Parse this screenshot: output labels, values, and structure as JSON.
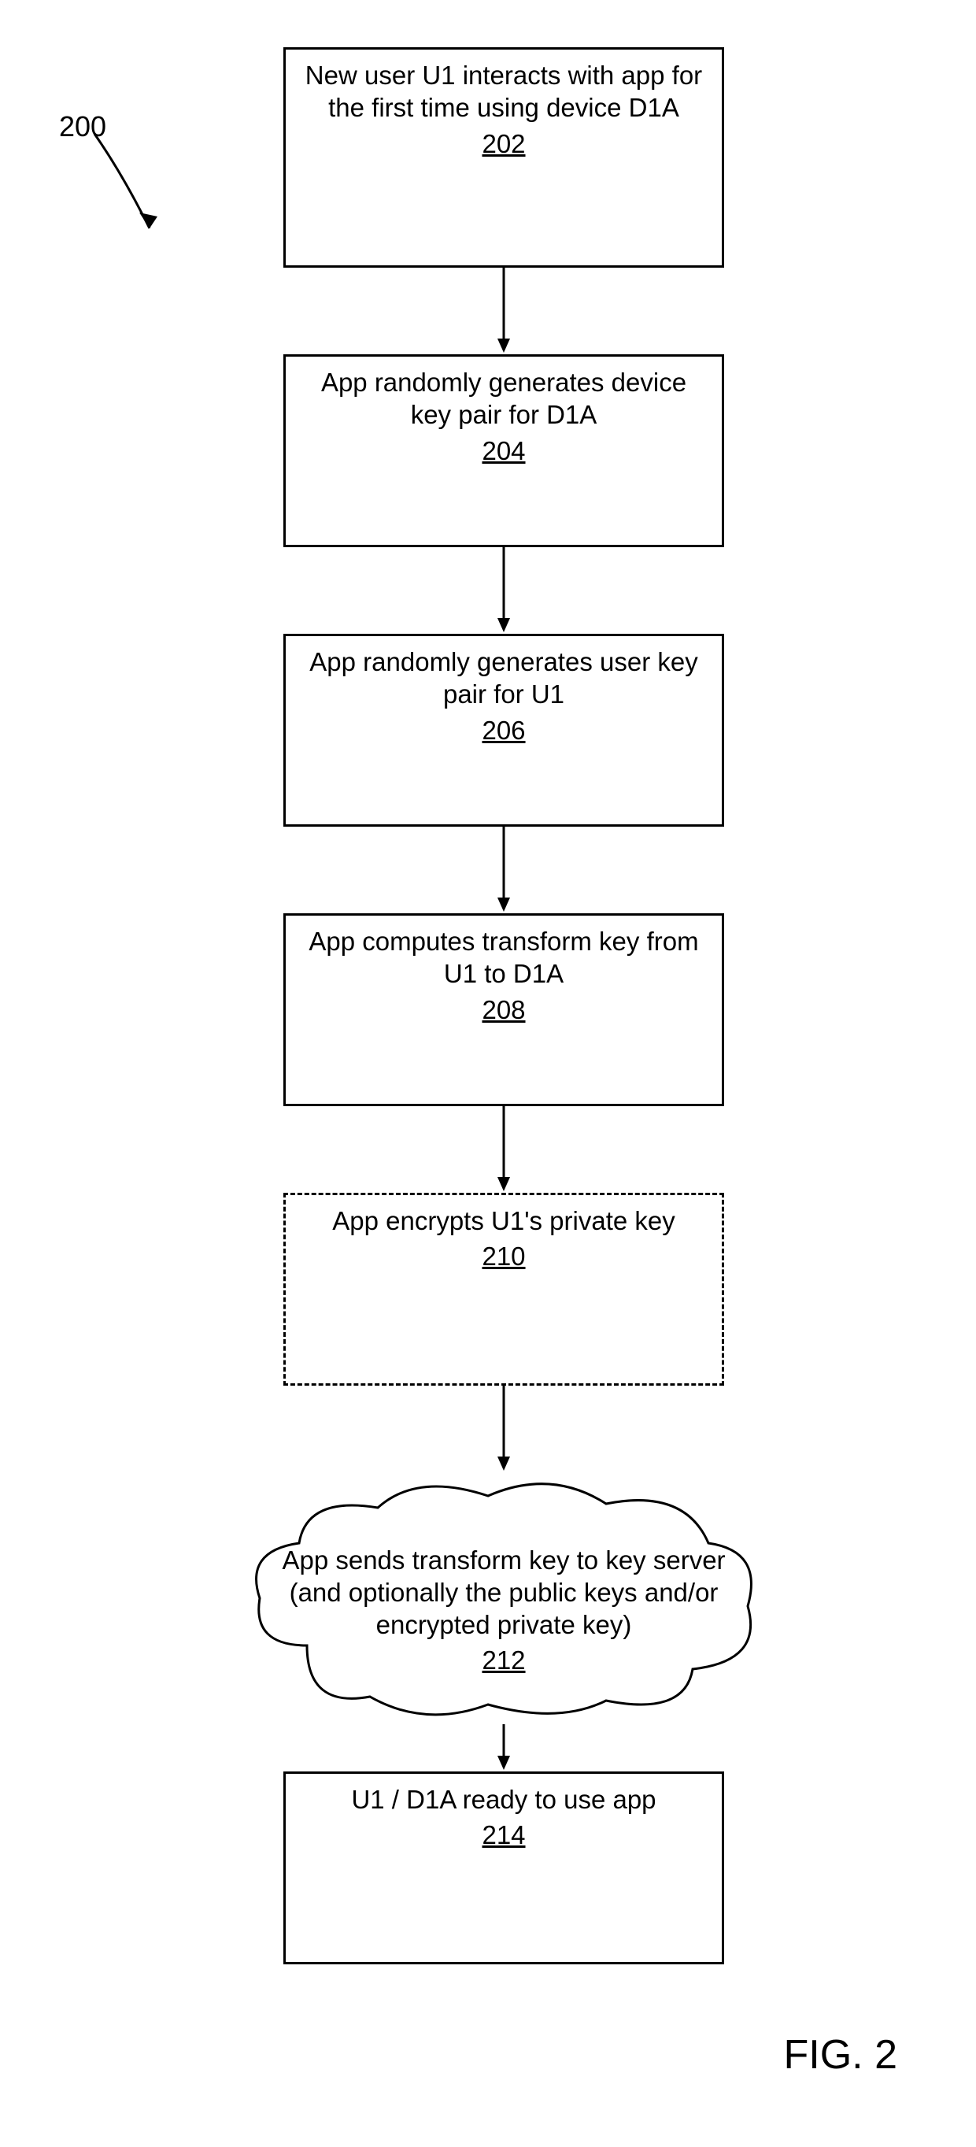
{
  "diagram_number": "200",
  "figure_label": "FIG. 2",
  "steps": {
    "s202": {
      "text": "New user U1 interacts with app for the first time using device D1A",
      "num": "202"
    },
    "s204": {
      "text": "App randomly generates device key pair for D1A",
      "num": "204"
    },
    "s206": {
      "text": "App randomly generates user key pair for U1",
      "num": "206"
    },
    "s208": {
      "text": "App computes transform key from U1 to D1A",
      "num": "208"
    },
    "s210": {
      "text": "App encrypts U1's private key",
      "num": "210"
    },
    "s212": {
      "text": "App sends transform key to key server (and optionally the public keys and/or encrypted private key)",
      "num": "212"
    },
    "s214": {
      "text": "U1 / D1A ready to use app",
      "num": "214"
    }
  }
}
